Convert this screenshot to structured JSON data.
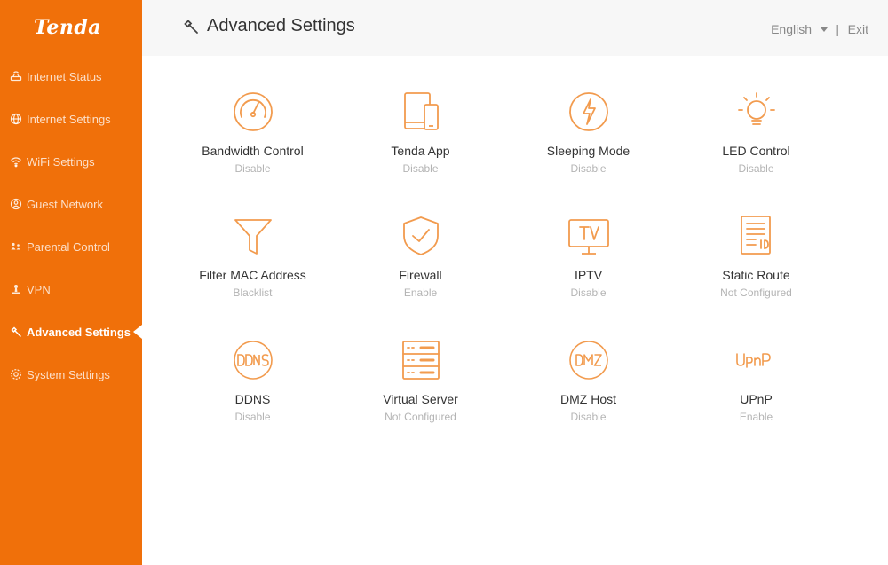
{
  "brand": {
    "logo_text": "Tenda",
    "accent": "#f0700a",
    "icon_color": "#f29b4e"
  },
  "sidebar": {
    "items": [
      {
        "label": "Internet Status",
        "icon": "router-icon",
        "active": false
      },
      {
        "label": "Internet Settings",
        "icon": "globe-icon",
        "active": false
      },
      {
        "label": "WiFi Settings",
        "icon": "wifi-icon",
        "active": false
      },
      {
        "label": "Guest Network",
        "icon": "guest-icon",
        "active": false
      },
      {
        "label": "Parental Control",
        "icon": "family-icon",
        "active": false
      },
      {
        "label": "VPN",
        "icon": "vpn-icon",
        "active": false
      },
      {
        "label": "Advanced Settings",
        "icon": "wrench-icon",
        "active": true
      },
      {
        "label": "System Settings",
        "icon": "gear-icon",
        "active": false
      }
    ]
  },
  "header": {
    "title": "Advanced Settings",
    "title_icon": "wrench-icon",
    "language": "English",
    "separator": "|",
    "exit_label": "Exit"
  },
  "tiles": [
    {
      "name": "Bandwidth Control",
      "status": "Disable",
      "icon": "gauge-icon"
    },
    {
      "name": "Tenda App",
      "status": "Disable",
      "icon": "devices-icon"
    },
    {
      "name": "Sleeping Mode",
      "status": "Disable",
      "icon": "sleep-icon"
    },
    {
      "name": "LED Control",
      "status": "Disable",
      "icon": "bulb-icon"
    },
    {
      "name": "Filter MAC Address",
      "status": "Blacklist",
      "icon": "filter-icon"
    },
    {
      "name": "Firewall",
      "status": "Enable",
      "icon": "shield-icon"
    },
    {
      "name": "IPTV",
      "status": "Disable",
      "icon": "tv-icon"
    },
    {
      "name": "Static Route",
      "status": "Not Configured",
      "icon": "route-icon"
    },
    {
      "name": "DDNS",
      "status": "Disable",
      "icon": "ddns-icon"
    },
    {
      "name": "Virtual Server",
      "status": "Not Configured",
      "icon": "server-icon"
    },
    {
      "name": "DMZ Host",
      "status": "Disable",
      "icon": "dmz-icon"
    },
    {
      "name": "UPnP",
      "status": "Enable",
      "icon": "upnp-icon"
    }
  ]
}
